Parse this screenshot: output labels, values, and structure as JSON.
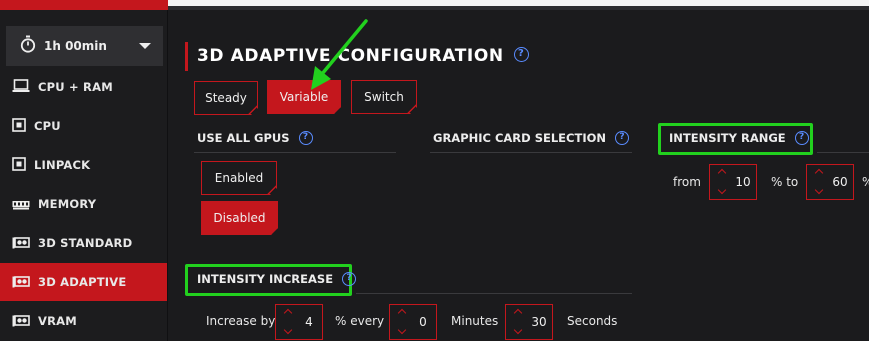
{
  "sidebar": {
    "timer": {
      "label": "1h 00min",
      "icon": "stopwatch-icon"
    },
    "items": [
      {
        "label": "CPU + RAM",
        "icon": "laptop-icon"
      },
      {
        "label": "CPU",
        "icon": "chip-icon"
      },
      {
        "label": "LINPACK",
        "icon": "chip-icon"
      },
      {
        "label": "MEMORY",
        "icon": "memory-icon"
      },
      {
        "label": "3D STANDARD",
        "icon": "gpu-icon"
      },
      {
        "label": "3D ADAPTIVE",
        "icon": "gpu-icon",
        "active": true
      },
      {
        "label": "VRAM",
        "icon": "gpu-icon"
      }
    ]
  },
  "main": {
    "title": "3D ADAPTIVE CONFIGURATION",
    "modes": [
      "Steady",
      "Variable",
      "Switch"
    ],
    "selected_mode": "Variable",
    "use_all_gpus": {
      "label": "USE ALL GPUS",
      "enabled_label": "Enabled",
      "disabled_label": "Disabled",
      "selected": "Disabled"
    },
    "graphic_card_selection": {
      "label": "GRAPHIC CARD SELECTION"
    },
    "intensity_range": {
      "label": "INTENSITY RANGE",
      "from_label": "from",
      "from_value": "10",
      "to_label": "% to",
      "to_value": "60",
      "unit": "%"
    },
    "intensity_increase": {
      "label": "INTENSITY INCREASE",
      "increase_by_label": "Increase by",
      "increase_value": "4",
      "every_label": "% every",
      "minutes_value": "0",
      "minutes_label": "Minutes",
      "seconds_value": "30",
      "seconds_label": "Seconds"
    }
  },
  "colors": {
    "accent": "#c4171d",
    "highlight": "#22d11e",
    "help": "#5a8cff",
    "background": "#1b1b1d"
  }
}
